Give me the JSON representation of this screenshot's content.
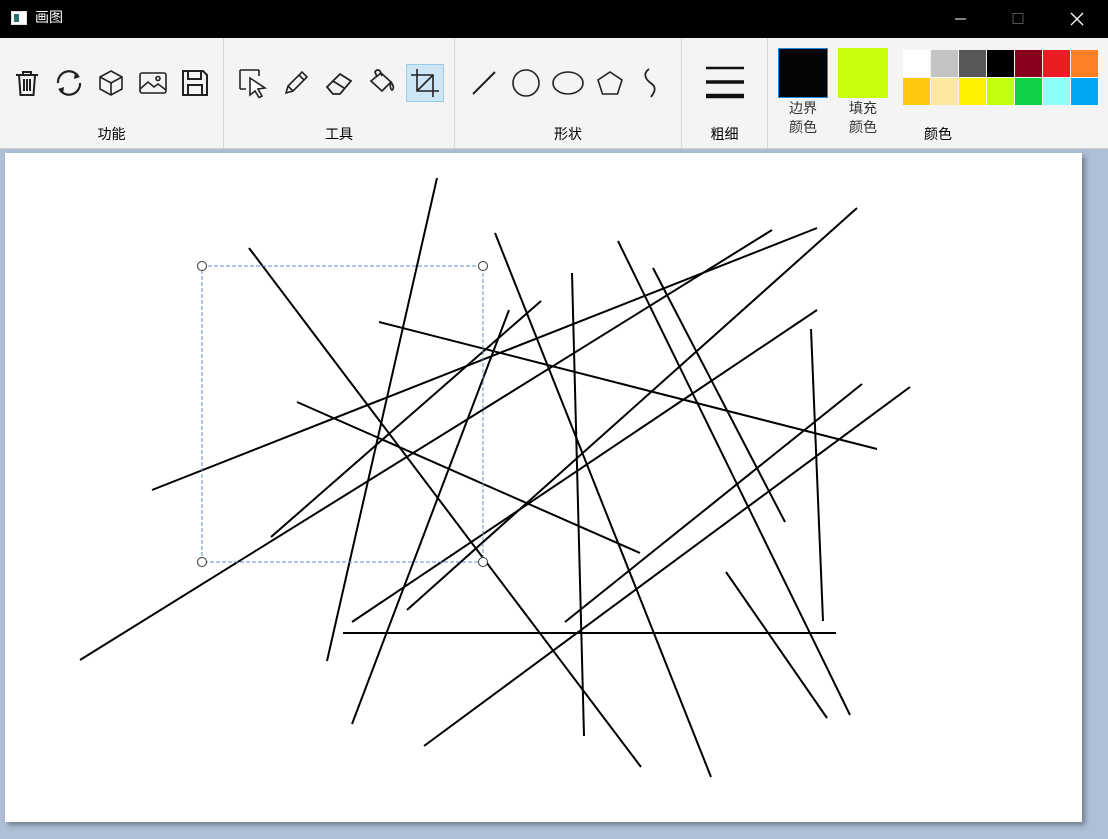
{
  "window": {
    "title": "画图"
  },
  "ribbon": {
    "groups": {
      "functions": "功能",
      "tools": "工具",
      "shapes": "形状",
      "thickness": "粗细",
      "colors": "颜色"
    },
    "function_buttons": [
      "trash-icon",
      "rotate-icon",
      "3d-cube-icon",
      "image-icon",
      "save-icon"
    ],
    "tool_buttons": [
      "select-cursor-icon",
      "pencil-icon",
      "eraser-icon",
      "paint-bucket-icon",
      "crop-icon"
    ],
    "active_tool": "crop-icon",
    "shape_buttons": [
      "line-icon",
      "circle-icon",
      "ellipse-icon",
      "pentagon-icon",
      "curve-icon"
    ],
    "border_color": {
      "label_line1": "边界",
      "label_line2": "颜色",
      "value": "#050505"
    },
    "fill_color": {
      "label_line1": "填充",
      "label_line2": "颜色",
      "value": "#c8ff0a"
    },
    "palette": [
      [
        "#ffffff",
        "#c3c3c3",
        "#585858",
        "#000000",
        "#88001b",
        "#ec1c24",
        "#ff7f27"
      ],
      [
        "#ffc90e",
        "#fde89f",
        "#fff200",
        "#c4ff0e",
        "#0ed145",
        "#8cfffb",
        "#00a8f3"
      ]
    ]
  }
}
